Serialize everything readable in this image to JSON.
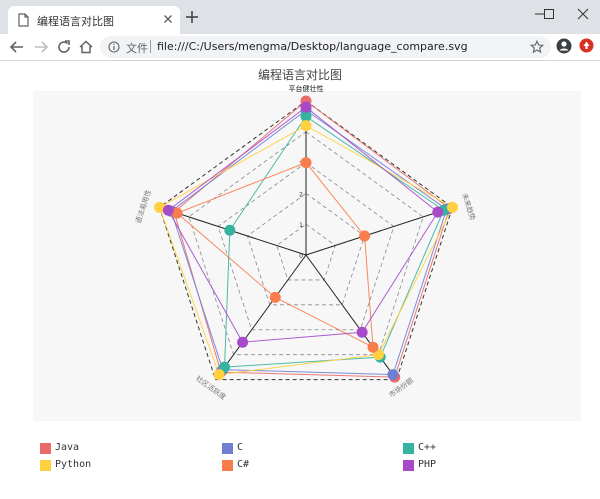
{
  "window": {
    "tab_title": "编程语言对比图",
    "scheme_label": "文件",
    "url": "file:///C:/Users/mengma/Desktop/language_compare.svg"
  },
  "page": {
    "title": "编程语言对比图"
  },
  "chart_data": {
    "type": "radar",
    "title": "编程语言对比图",
    "axes": [
      "平台健壮性",
      "未来趋势",
      "市场份额",
      "社区活跃度",
      "语法易用性"
    ],
    "rlim": [
      0,
      5
    ],
    "radial_ticks": [
      0,
      1,
      2,
      3
    ],
    "series": [
      {
        "name": "Java",
        "color": "#e96a6a",
        "values": [
          5.0,
          4.9,
          4.9,
          4.7,
          4.5
        ]
      },
      {
        "name": "C",
        "color": "#6f7fd1",
        "values": [
          4.7,
          4.8,
          4.8,
          4.6,
          4.6
        ]
      },
      {
        "name": "C++",
        "color": "#38b2a0",
        "values": [
          4.5,
          4.7,
          4.1,
          4.5,
          2.6
        ]
      },
      {
        "name": "Python",
        "color": "#ffd13f",
        "values": [
          4.2,
          5.0,
          4.0,
          4.8,
          5.0
        ]
      },
      {
        "name": "C#",
        "color": "#f97c4d",
        "values": [
          3.0,
          2.0,
          3.7,
          1.7,
          4.4
        ]
      },
      {
        "name": "PHP",
        "color": "#a64ac9",
        "values": [
          4.8,
          4.5,
          3.1,
          3.5,
          4.7
        ]
      }
    ],
    "marker_colors": {
      "平台健壮性": [
        "#f7582d",
        "#9b47c4",
        "#22a08c",
        "#f7c11c",
        "#f7582d",
        "#9b47c4"
      ],
      "未来趋势": [
        "#22a08c",
        "#f7c11c",
        "#9b47c4",
        "#f7582d"
      ]
    },
    "legend_position": "bottom",
    "grid": true
  }
}
